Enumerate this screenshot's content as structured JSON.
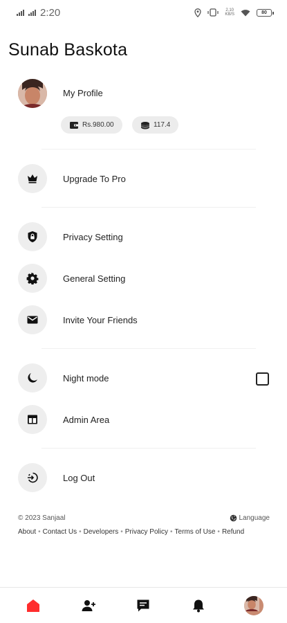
{
  "status_bar": {
    "time": "2:20",
    "speed_top": "2.10",
    "speed_bottom": "KB/S",
    "battery": "80"
  },
  "profile": {
    "name": "Sunab Baskota",
    "my_profile_label": "My Profile",
    "wallet_balance": "Rs.980.00",
    "coin_balance": "117.4"
  },
  "menu": {
    "upgrade": "Upgrade To Pro",
    "privacy": "Privacy Setting",
    "general": "General Setting",
    "invite": "Invite Your Friends",
    "night_mode": "Night mode",
    "admin": "Admin Area",
    "logout": "Log Out"
  },
  "night_mode_enabled": false,
  "footer": {
    "copyright": "© 2023 Sanjaal",
    "language": "Language",
    "links": [
      "About",
      "Contact Us",
      "Developers",
      "Privacy Policy",
      "Terms of Use",
      "Refund"
    ]
  },
  "bottom_nav": [
    {
      "icon": "home-icon",
      "active": true
    },
    {
      "icon": "add-friend-icon",
      "active": false
    },
    {
      "icon": "messages-icon",
      "active": false
    },
    {
      "icon": "notifications-icon",
      "active": false
    },
    {
      "icon": "profile-avatar",
      "active": false
    }
  ],
  "colors": {
    "accent": "#ff2d2d",
    "icon_bg": "#eeeeee",
    "text": "#222222"
  }
}
